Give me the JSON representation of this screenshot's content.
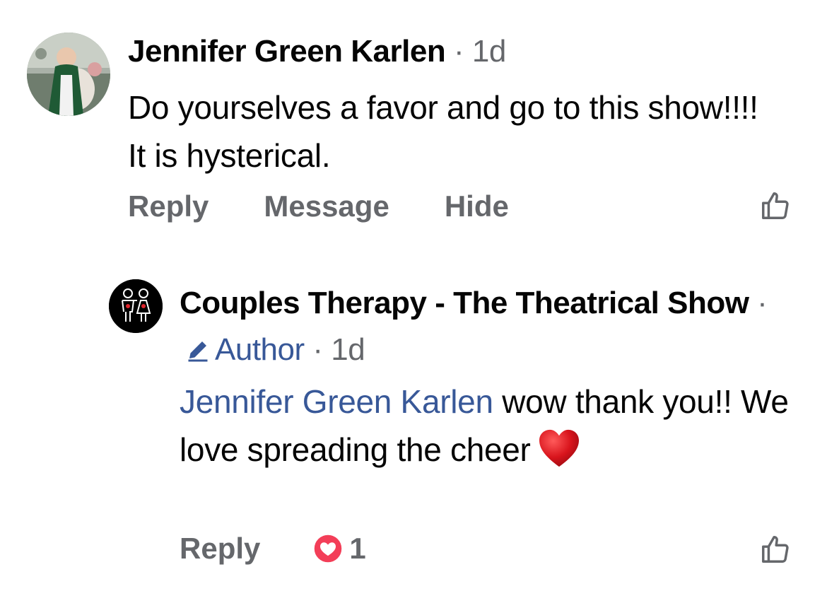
{
  "comment1": {
    "author": "Jennifer Green Karlen",
    "separator": "·",
    "time": "1d",
    "text": "Do yourselves a favor and go to this show!!!! It is hysterical.",
    "actions": {
      "reply": "Reply",
      "message": "Message",
      "hide": "Hide"
    },
    "like_icon": "thumbs-up-icon"
  },
  "comment2": {
    "author": "Couples Therapy - The Theatrical Show",
    "separator1": "·",
    "badge": "Author",
    "separator2": "·",
    "time": "1d",
    "mention": "Jennifer Green Karlen",
    "text": " wow thank you!! We love spreading the cheer",
    "emoji": "red-heart",
    "actions": {
      "reply": "Reply",
      "reaction_count": "1"
    },
    "reaction_icon": "love-reaction-icon",
    "like_icon": "thumbs-up-icon"
  },
  "colors": {
    "text": "#050505",
    "secondary": "#65676b",
    "link": "#385898",
    "love": "#f33e58"
  }
}
